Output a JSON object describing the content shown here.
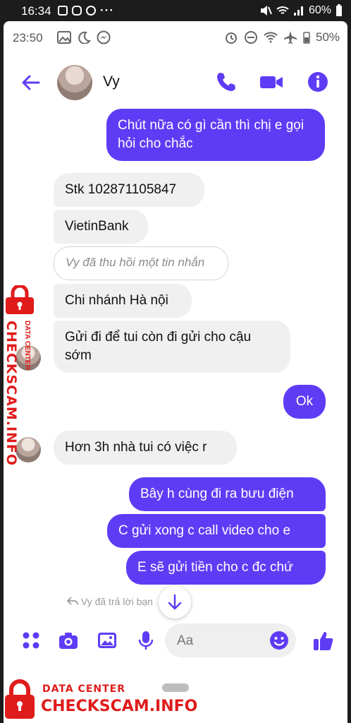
{
  "outer_status": {
    "time": "16:34",
    "battery": "60%"
  },
  "inner_status": {
    "time": "23:50",
    "battery": "50%"
  },
  "header": {
    "name": "Vy"
  },
  "messages": {
    "m1": "Chút nữa có gì cần thì chị e gọi hỏi cho chắc",
    "m2": "Stk 102871105847",
    "m3": "VietinBank",
    "m4": "Vy đã thu hồi một tin nhắn",
    "m5": "Chi nhánh Hà nội",
    "m6": "Gửi đi để tui còn đi gửi cho cậu sớm",
    "m7": "Ok",
    "m8": "Hơn 3h nhà tui có việc r",
    "m9": "Bây h cùng đi ra bưu điện",
    "m10": "C gửi xong c call video cho e",
    "m11": "E sẽ gửi tiền cho c đc chứ",
    "reply_note": "Vy đã trả lời bạn"
  },
  "composer": {
    "placeholder": "Aa"
  },
  "watermark": {
    "small": "DATA CENTER",
    "big": "CHECKSCAM.INFO"
  },
  "colors": {
    "accent": "#5e3cf5",
    "watermark": "#e01b1b"
  }
}
